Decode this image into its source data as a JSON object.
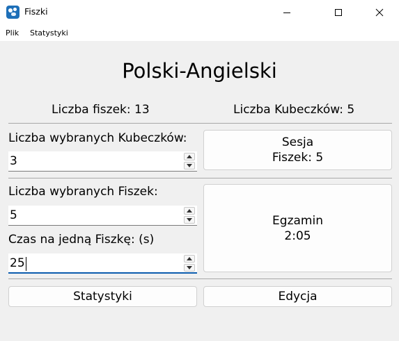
{
  "window": {
    "title": "Fiszki"
  },
  "menu": {
    "items": [
      "Plik",
      "Statystyki"
    ]
  },
  "main": {
    "title": "Polski-Angielski",
    "flashcard_count": "Liczba fiszek: 13",
    "bucket_count": "Liczba Kubeczków: 5",
    "selected_buckets_label": "Liczba wybranych Kubeczków:",
    "selected_buckets_value": "3",
    "selected_cards_label": "Liczba wybranych Fiszek:",
    "selected_cards_value": "5",
    "time_per_card_label": "Czas na jedną Fiszkę: (s)",
    "time_per_card_value": "25",
    "session_button": {
      "line1": "Sesja",
      "line2": "Fiszek: 5"
    },
    "exam_button": {
      "line1": "Egzamin",
      "line2": "2:05"
    },
    "stats_button": "Statystyki",
    "edit_button": "Edycja"
  },
  "colors": {
    "app_icon": "#1d6fb8",
    "focus_accent": "#0b5cad",
    "background": "#f0f0f0"
  }
}
